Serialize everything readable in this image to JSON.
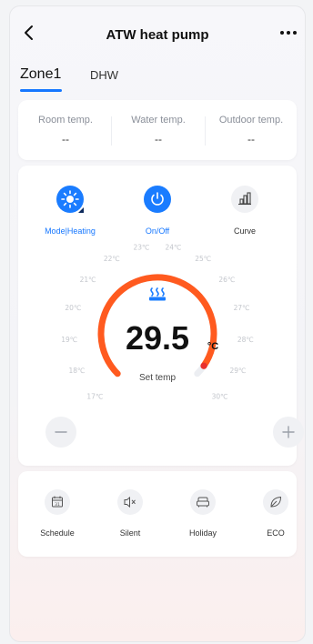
{
  "header": {
    "title": "ATW heat pump"
  },
  "tabs": [
    {
      "label": "Zone1"
    },
    {
      "label": "DHW"
    }
  ],
  "temps": [
    {
      "label": "Room temp.",
      "value": "--"
    },
    {
      "label": "Water temp.",
      "value": "--"
    },
    {
      "label": "Outdoor temp.",
      "value": "--"
    }
  ],
  "controls": [
    {
      "label": "Mode|Heating",
      "icon": "sun-icon"
    },
    {
      "label": "On/Off",
      "icon": "power-icon"
    },
    {
      "label": "Curve",
      "icon": "curve-chart-icon"
    }
  ],
  "dial": {
    "ticks": [
      "17℃",
      "18℃",
      "19℃",
      "20℃",
      "21℃",
      "22℃",
      "23℃",
      "24℃",
      "25℃",
      "26℃",
      "27℃",
      "28℃",
      "29℃",
      "30℃"
    ],
    "setpoint": "29.5",
    "unit": "°C",
    "label": "Set temp",
    "setpoint_value": 29.5,
    "range": [
      17,
      30
    ]
  },
  "features": [
    {
      "label": "Schedule",
      "icon": "calendar-icon"
    },
    {
      "label": "Silent",
      "icon": "speaker-mute-icon"
    },
    {
      "label": "Holiday",
      "icon": "sofa-icon"
    },
    {
      "label": "ECO",
      "icon": "leaf-icon"
    }
  ],
  "colors": {
    "accent": "#1a7cff",
    "arc": "#ff5a1f",
    "mode_label": "#1677ff"
  }
}
